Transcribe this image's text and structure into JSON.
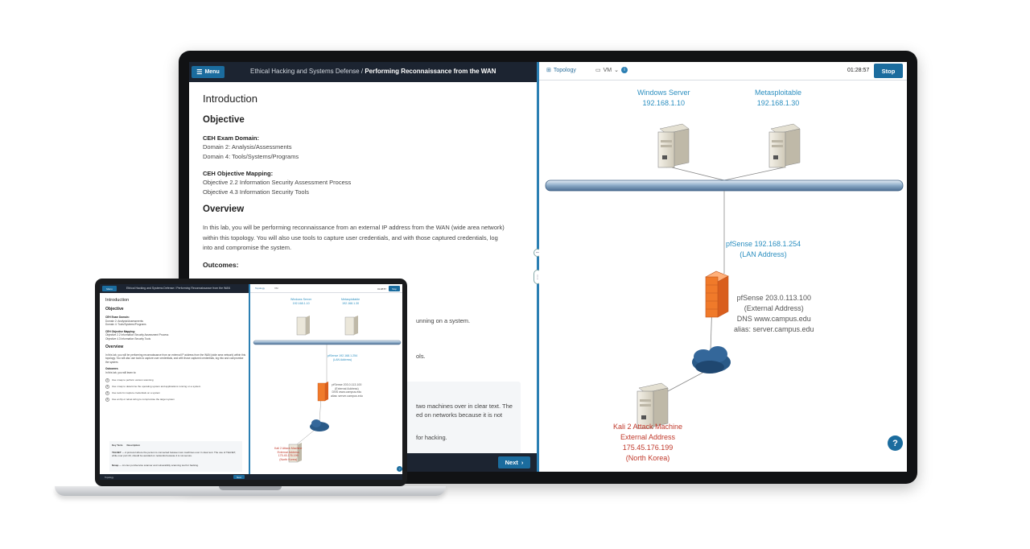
{
  "header": {
    "menu_label": "Menu",
    "breadcrumb_course": "Ethical Hacking and Systems Defense /",
    "breadcrumb_lab": "Performing Reconnaissance from the WAN"
  },
  "content": {
    "introduction": "Introduction",
    "objective": "Objective",
    "ceh_domain_label": "CEH Exam Domain:",
    "domains": [
      "Domain 2: Analysis/Assessments",
      "Domain 4: Tools/Systems/Programs"
    ],
    "ceh_mapping_label": "CEH Objective Mapping:",
    "objectives": [
      "Objective 2.2 Information Security Assessment Process",
      "Objective 4.3 Information Security Tools"
    ],
    "overview": "Overview",
    "overview_text": "In this lab, you will be performing reconnaissance from an external IP address from the WAN (wide area network) within this topology. You will also use tools to capture user credentials, and with those captured credentials, log into and compromise the system.",
    "outcomes": "Outcomes:",
    "fragments": [
      "unning on a system.",
      "ols.",
      "two machines over in clear text. The",
      "ed on networks because it is not",
      "for hacking."
    ]
  },
  "footer": {
    "next_label": "Next"
  },
  "topology": {
    "tab_topology": "Topology",
    "tab_vm": "VM",
    "timer": "01:28:57",
    "stop_label": "Stop",
    "help_label": "?",
    "windows_server": {
      "name": "Windows Server",
      "ip": "192.168.1.10"
    },
    "metasploitable": {
      "name": "Metasploitable",
      "ip": "192.168.1.30"
    },
    "pfsense_lan": {
      "line1": "pfSense  192.168.1.254",
      "line2": "(LAN  Address)"
    },
    "pfsense_wan": {
      "line1": "pfSense 203.0.113.100",
      "line2": "(External  Address)",
      "line3": "DNS www.campus.edu",
      "line4": "alias: server.campus.edu"
    },
    "kali": {
      "line1": "Kali 2 Attack Machine",
      "line2": "External Address",
      "line3": "175.45.176.199",
      "line4": "(North Korea)"
    }
  },
  "laptop": {
    "breadcrumb": "Ethical Hacking and Systems Defense / Performing Reconnaissance from the WAN",
    "outcomes_label": "Outcomes",
    "outcomes_intro": "In this lab, you will learn to:",
    "outcomes": [
      "Use nmap to perform version scanning",
      "Use nmap to determine the operating system and applications running on a system",
      "Use tools for capture credentials on a system",
      "Use an ftp or telnet string to compromise the target system"
    ],
    "table_header_key": "Key Term",
    "table_header_desc": "Description",
    "table_rows": [
      {
        "term": "TELNET",
        "desc": "A protocol where the person is connected between two machines over in clear text. The use of TELNET, while over port 23, should be avoided on networks because it is not secure."
      },
      {
        "term": "Nmap",
        "desc": "A Linux port/service scanner and vulnerability scanning tool for hacking."
      }
    ],
    "footer_left": "Topology",
    "footer_next": "Next"
  },
  "colors": {
    "accent": "#1b6c9e",
    "header_bg": "#1c2431",
    "topology_label": "#2c8fc0",
    "kali_label": "#c0392b",
    "firewall": "#f07a2a"
  }
}
